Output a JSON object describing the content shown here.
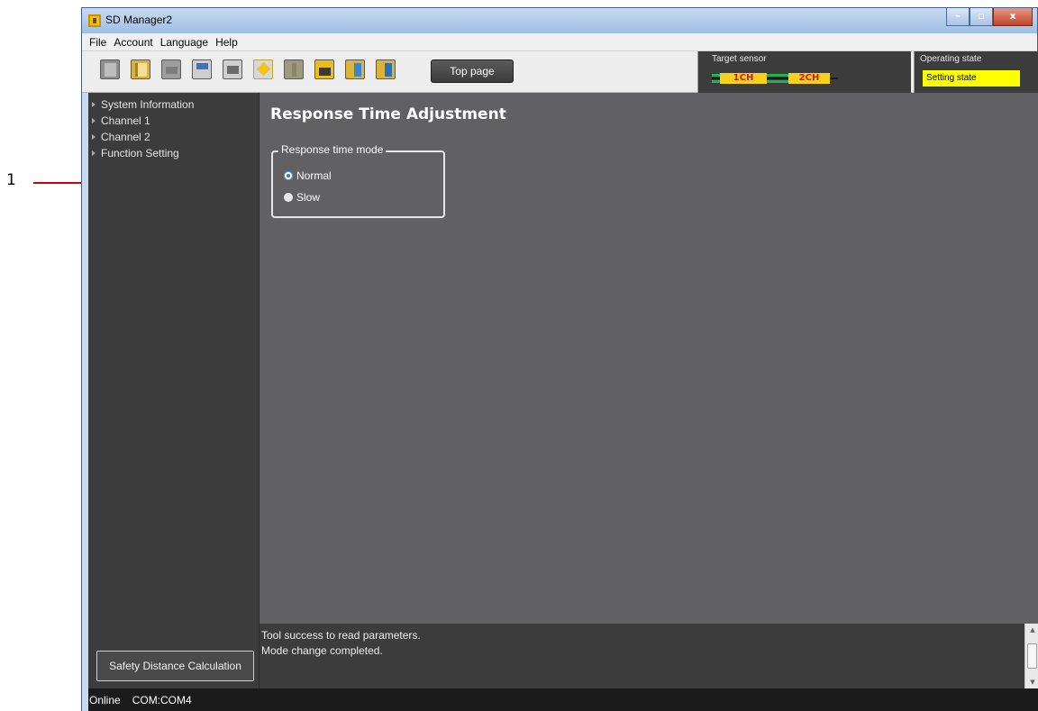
{
  "callout": {
    "number": "1"
  },
  "window": {
    "title": "SD Manager2",
    "minimize": "–",
    "maximize": "▫",
    "close": "x"
  },
  "menu": [
    "File",
    "Account",
    "Language",
    "Help"
  ],
  "toolbar": {
    "buttons": [
      "new-document-icon",
      "open-file-icon",
      "disabled-icon",
      "save-to-pc-icon",
      "print-icon",
      "connect-icon",
      "disabled-key-icon",
      "lock-icon",
      "read-from-sensor-icon",
      "write-to-sensor-icon"
    ],
    "top_page_label": "Top page"
  },
  "target_sensor": {
    "label": "Target sensor",
    "ch1": "1CH",
    "ch2": "2CH"
  },
  "operating_state": {
    "label": "Operating state",
    "value": "Setting state",
    "color": "#ffff00"
  },
  "sidebar": {
    "items": [
      "System Information",
      "Channel 1",
      "Channel 2",
      "Function Setting"
    ],
    "safety_button": "Safety Distance Calculation"
  },
  "main": {
    "title": "Response Time Adjustment",
    "group_label": "Response time mode",
    "options": [
      {
        "label": "Normal",
        "selected": true
      },
      {
        "label": "Slow",
        "selected": false
      }
    ]
  },
  "log": {
    "lines": [
      "Tool success to read parameters.",
      "Mode change completed."
    ]
  },
  "status": {
    "connection": "Online",
    "port": "COM:COM4"
  }
}
